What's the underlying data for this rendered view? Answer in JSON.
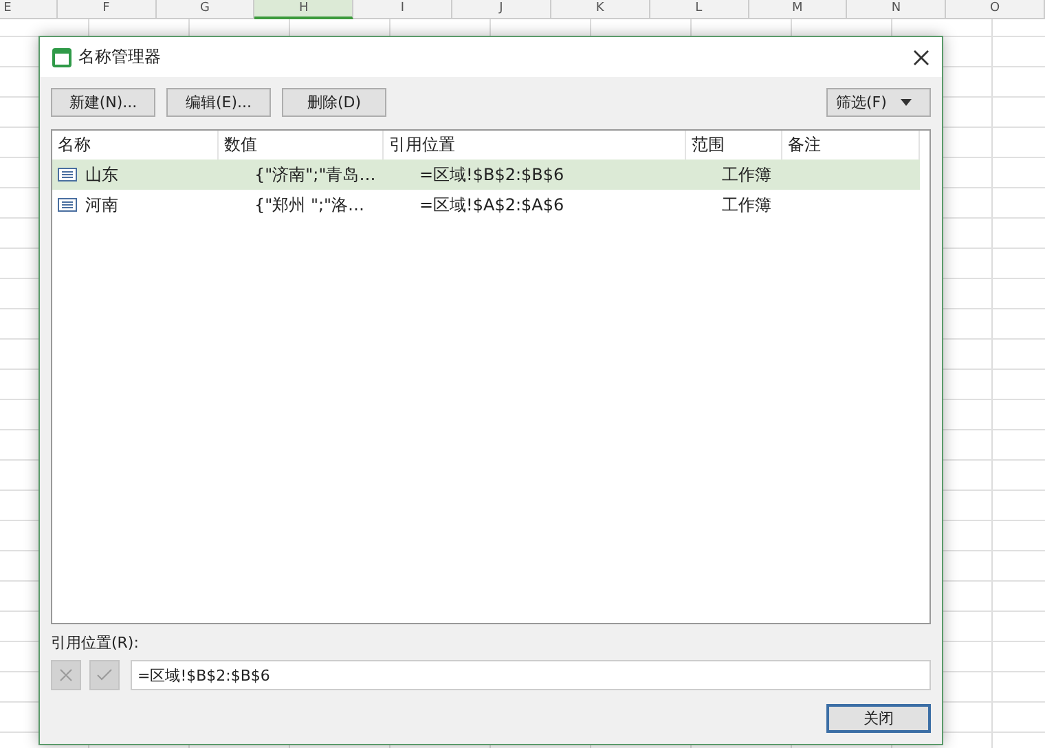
{
  "sheet": {
    "columns": [
      {
        "label": "E",
        "selected": false
      },
      {
        "label": "F",
        "selected": false
      },
      {
        "label": "G",
        "selected": false
      },
      {
        "label": "H",
        "selected": true
      },
      {
        "label": "I",
        "selected": false
      },
      {
        "label": "J",
        "selected": false
      },
      {
        "label": "K",
        "selected": false
      },
      {
        "label": "L",
        "selected": false
      },
      {
        "label": "M",
        "selected": false
      },
      {
        "label": "N",
        "selected": false
      },
      {
        "label": "O",
        "selected": false
      }
    ]
  },
  "dialog": {
    "title": "名称管理器",
    "buttons": [
      {
        "label": "新建(N)..."
      },
      {
        "label": "编辑(E)..."
      },
      {
        "label": "删除(D)"
      }
    ],
    "filter": {
      "label": "筛选(F)"
    },
    "table": {
      "columns": [
        "名称",
        "数值",
        "引用位置",
        "范围",
        "备注"
      ],
      "rows": [
        {
          "name": "山东",
          "value": "{\"济南\";\"青岛…",
          "ref": "=区域!$B$2:$B$6",
          "scope": "工作簿",
          "selected": true
        },
        {
          "name": "河南",
          "value": "{\"郑州  \";\"洛…",
          "ref": "=区域!$A$2:$A$6",
          "scope": "工作簿",
          "selected": false
        }
      ]
    },
    "ref_label": "引用位置(R):",
    "ref_value": "=区域!$B$2:$B$6",
    "close": "关闭"
  }
}
